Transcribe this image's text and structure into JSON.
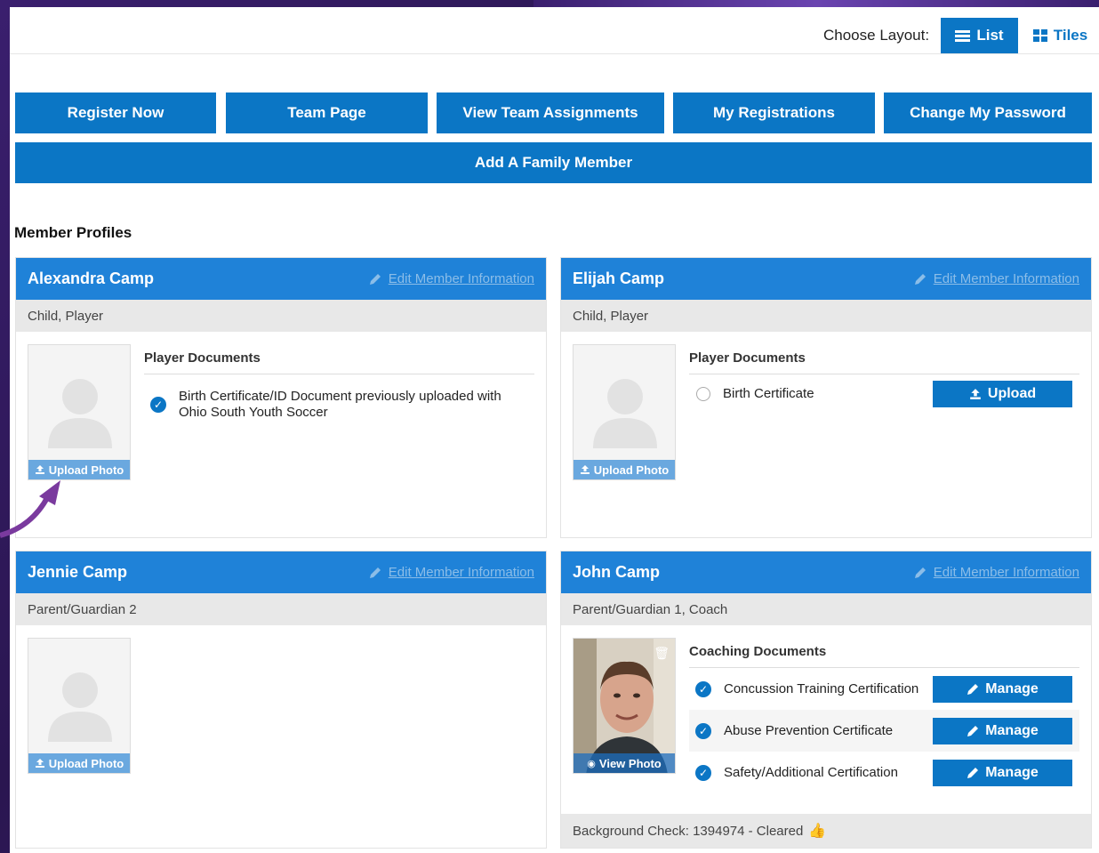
{
  "layout": {
    "label": "Choose Layout:",
    "list_label": "List",
    "tiles_label": "Tiles"
  },
  "nav": {
    "register_now": "Register Now",
    "team_page": "Team Page",
    "view_team_assignments": "View Team Assignments",
    "my_registrations": "My Registrations",
    "change_password": "Change My Password",
    "add_family_member": "Add A Family Member"
  },
  "section_title": "Member Profiles",
  "edit_label": "Edit Member Information",
  "upload_photo_label": "Upload Photo",
  "view_photo_label": "View Photo",
  "members": [
    {
      "name": "Alexandra Camp",
      "role": "Child, Player",
      "docs_title": "Player Documents",
      "docs": [
        {
          "text": "Birth Certificate/ID Document previously uploaded with Ohio South Youth Soccer",
          "status": "done"
        }
      ]
    },
    {
      "name": "Elijah Camp",
      "role": "Child, Player",
      "docs_title": "Player Documents",
      "docs": [
        {
          "text": "Birth Certificate",
          "status": "pending",
          "action": "Upload"
        }
      ]
    },
    {
      "name": "Jennie Camp",
      "role": "Parent/Guardian 2"
    },
    {
      "name": "John Camp",
      "role": "Parent/Guardian 1, Coach",
      "docs_title": "Coaching Documents",
      "docs": [
        {
          "text": "Concussion Training Certification",
          "status": "done",
          "action": "Manage"
        },
        {
          "text": "Abuse Prevention Certificate",
          "status": "done",
          "action": "Manage"
        },
        {
          "text": "Safety/Additional Certification",
          "status": "done",
          "action": "Manage"
        }
      ],
      "background_check": "Background Check: 1394974 - Cleared"
    }
  ],
  "colors": {
    "primary": "#0b76c5",
    "card_header": "#1f82d8",
    "background": "#2a1650"
  }
}
